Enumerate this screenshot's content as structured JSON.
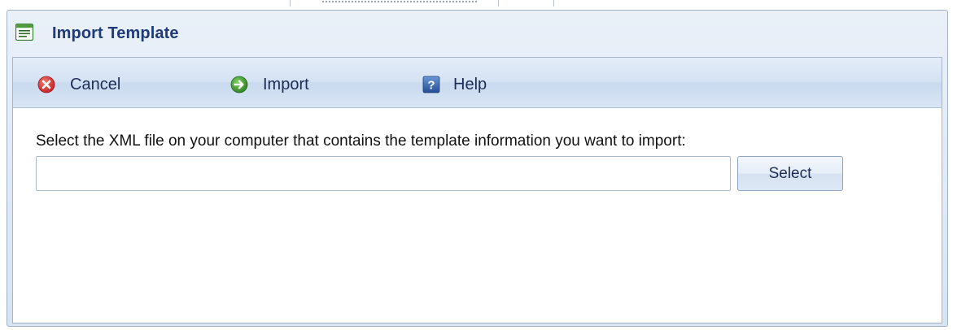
{
  "dialog": {
    "title": "Import Template",
    "title_icon": "template-document-icon"
  },
  "toolbar": {
    "cancel": {
      "label": "Cancel",
      "icon": "cancel-icon",
      "color": "#d2282e"
    },
    "import": {
      "label": "Import",
      "icon": "import-arrow-icon",
      "color": "#3f9a2f"
    },
    "help": {
      "label": "Help",
      "icon": "help-icon",
      "color": "#2f5fa8"
    }
  },
  "form": {
    "instruction": "Select the XML file on your computer that contains the template information you want to import:",
    "file_path": {
      "value": "",
      "placeholder": ""
    },
    "select_label": "Select"
  },
  "colors": {
    "title_text": "#1e3a7a",
    "toolbar_bg": "#d4e2f3",
    "border": "#9fb2c9"
  }
}
